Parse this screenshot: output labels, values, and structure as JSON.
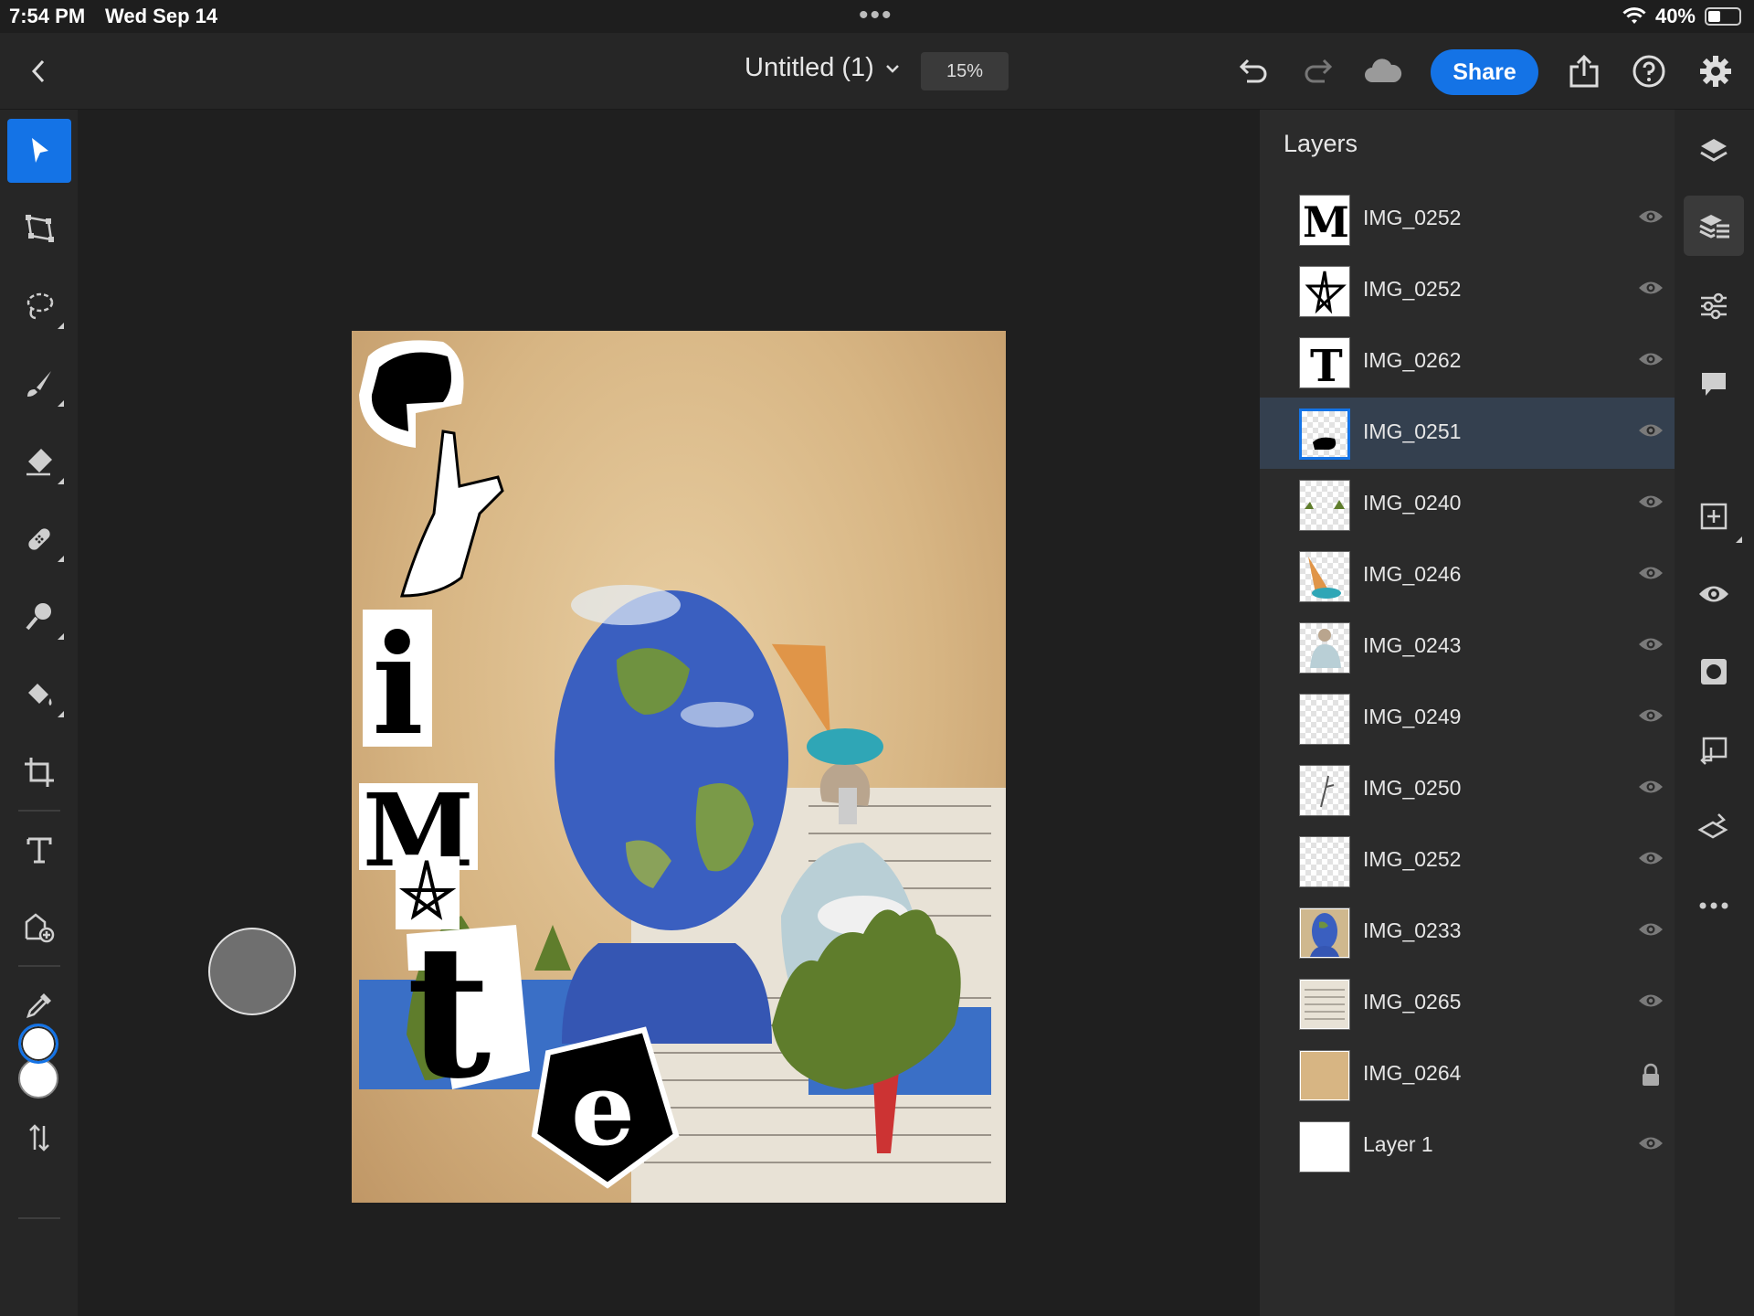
{
  "status_bar": {
    "time": "7:54 PM",
    "date": "Wed Sep 14",
    "battery": "40%",
    "battery_level": 0.4
  },
  "header": {
    "title": "Untitled (1)",
    "zoom": "15%",
    "share_label": "Share"
  },
  "layers_panel": {
    "title": "Layers",
    "layers": [
      {
        "name": "IMG_0252",
        "thumb": "M",
        "visible": true,
        "selected": false
      },
      {
        "name": "IMG_0252",
        "thumb": "star",
        "visible": true,
        "selected": false
      },
      {
        "name": "IMG_0262",
        "thumb": "T",
        "visible": true,
        "selected": false
      },
      {
        "name": "IMG_0251",
        "thumb": "blob",
        "visible": true,
        "selected": true
      },
      {
        "name": "IMG_0240",
        "thumb": "hands",
        "visible": true,
        "selected": false
      },
      {
        "name": "IMG_0246",
        "thumb": "cone",
        "visible": true,
        "selected": false
      },
      {
        "name": "IMG_0243",
        "thumb": "figure",
        "visible": true,
        "selected": false
      },
      {
        "name": "IMG_0249",
        "thumb": "empty",
        "visible": true,
        "selected": false
      },
      {
        "name": "IMG_0250",
        "thumb": "hand-sketch",
        "visible": true,
        "selected": false
      },
      {
        "name": "IMG_0252",
        "thumb": "empty",
        "visible": true,
        "selected": false
      },
      {
        "name": "IMG_0233",
        "thumb": "earth-head",
        "visible": true,
        "selected": false
      },
      {
        "name": "IMG_0265",
        "thumb": "newspaper",
        "visible": true,
        "selected": false
      },
      {
        "name": "IMG_0264",
        "thumb": "paper",
        "visible": true,
        "locked": true,
        "selected": false
      },
      {
        "name": "Layer 1",
        "thumb": "white",
        "visible": true,
        "selected": false
      }
    ]
  },
  "colors": {
    "accent": "#1473e6",
    "panel": "#2b2b2b",
    "selected_row": "#34404f"
  }
}
